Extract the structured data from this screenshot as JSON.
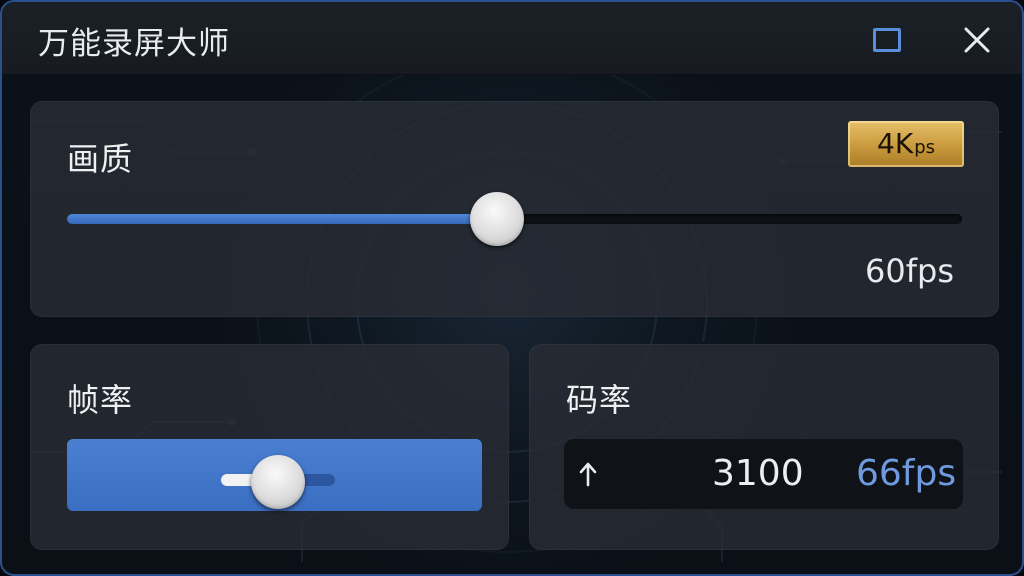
{
  "window": {
    "title": "万能录屏大师",
    "accent_color": "#4a7fd2",
    "border_color": "#2b4f8f"
  },
  "controls": {
    "maximize_icon": "maximize-icon",
    "close_icon": "close-icon"
  },
  "quality": {
    "label": "画质",
    "badge_main": "4K",
    "badge_sub": "ps",
    "badge_color": "#d4a94f",
    "value": "60fps",
    "slider_fraction": 0.48
  },
  "framerate": {
    "label": "帧率",
    "slider_fraction": 0.5
  },
  "bitrate": {
    "label": "码率",
    "icon": "arrow-up-icon",
    "value": "3100",
    "fps": "66fps"
  }
}
